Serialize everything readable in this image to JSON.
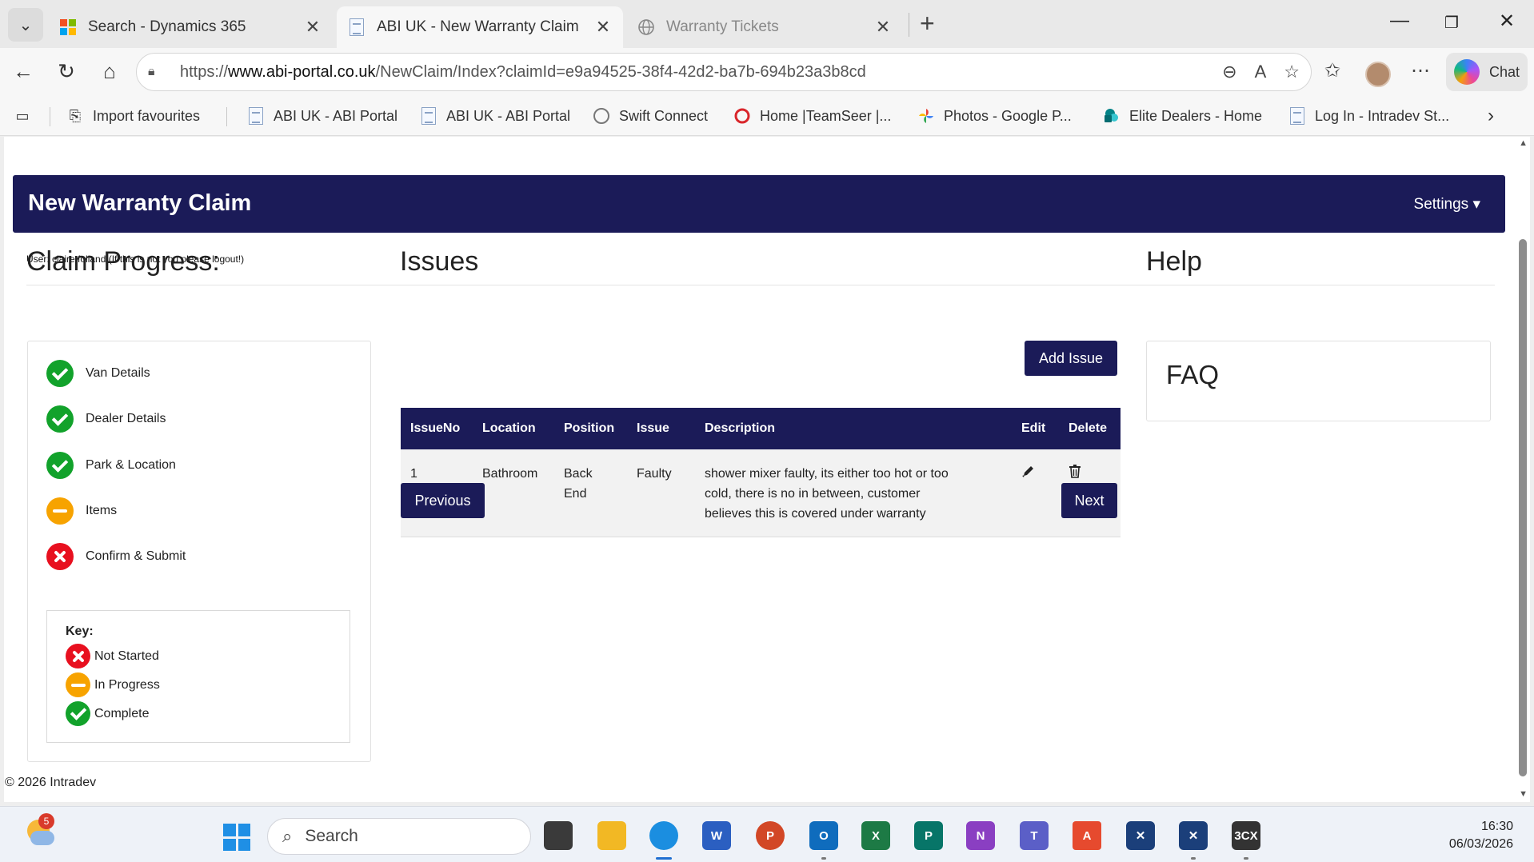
{
  "browser": {
    "tabs": [
      {
        "title": "Search - Dynamics 365",
        "close": "✕"
      },
      {
        "title": "ABI UK - New Warranty Claim",
        "close": "✕"
      },
      {
        "title": "Warranty Tickets",
        "close": "✕"
      }
    ],
    "url_prefix": "https://",
    "url_host": "www.abi-portal.co.uk",
    "url_path": "/NewClaim/Index?claimId=e9a94525-38f4-42d2-ba7b-694b23a3b8cd",
    "chat_label": "Chat",
    "favourites": [
      {
        "label": "Import favourites"
      },
      {
        "label": "ABI UK - ABI Portal"
      },
      {
        "label": "ABI UK - ABI Portal"
      },
      {
        "label": "Swift Connect"
      },
      {
        "label": "Home |TeamSeer |..."
      },
      {
        "label": "Photos - Google P..."
      },
      {
        "label": "Elite Dealers - Home"
      },
      {
        "label": "Log In - Intradev St..."
      }
    ]
  },
  "header": {
    "title": "New Warranty Claim",
    "settings_label": "Settings ▾"
  },
  "user_line": "User: claire.folland (If this is not you please logout!)",
  "progress": {
    "heading": "Claim Progress:",
    "steps": [
      {
        "label": "Van Details",
        "status": "complete"
      },
      {
        "label": "Dealer Details",
        "status": "complete"
      },
      {
        "label": "Park & Location",
        "status": "complete"
      },
      {
        "label": "Items",
        "status": "in-progress"
      },
      {
        "label": "Confirm & Submit",
        "status": "not-started"
      }
    ],
    "key": {
      "title": "Key:",
      "not_started": "Not Started",
      "in_progress": "In Progress",
      "complete": "Complete"
    }
  },
  "issues": {
    "heading": "Issues",
    "add_button": "Add Issue",
    "columns": [
      "IssueNo",
      "Location",
      "Position",
      "Issue",
      "Description",
      "Edit",
      "Delete"
    ],
    "rows": [
      {
        "issue_no": "1",
        "location": "Bathroom",
        "position": "Back End",
        "issue": "Faulty",
        "description": "shower mixer faulty, its either too hot or too cold, there is no in between, customer believes this is covered under warranty"
      }
    ],
    "previous_button": "Previous",
    "next_button": "Next"
  },
  "help": {
    "heading": "Help",
    "faq": "FAQ"
  },
  "footer": "© 2026 Intradev",
  "taskbar": {
    "notification_count": "5",
    "search_placeholder": "Search",
    "time": "16:30",
    "date": "06/03/2026"
  }
}
